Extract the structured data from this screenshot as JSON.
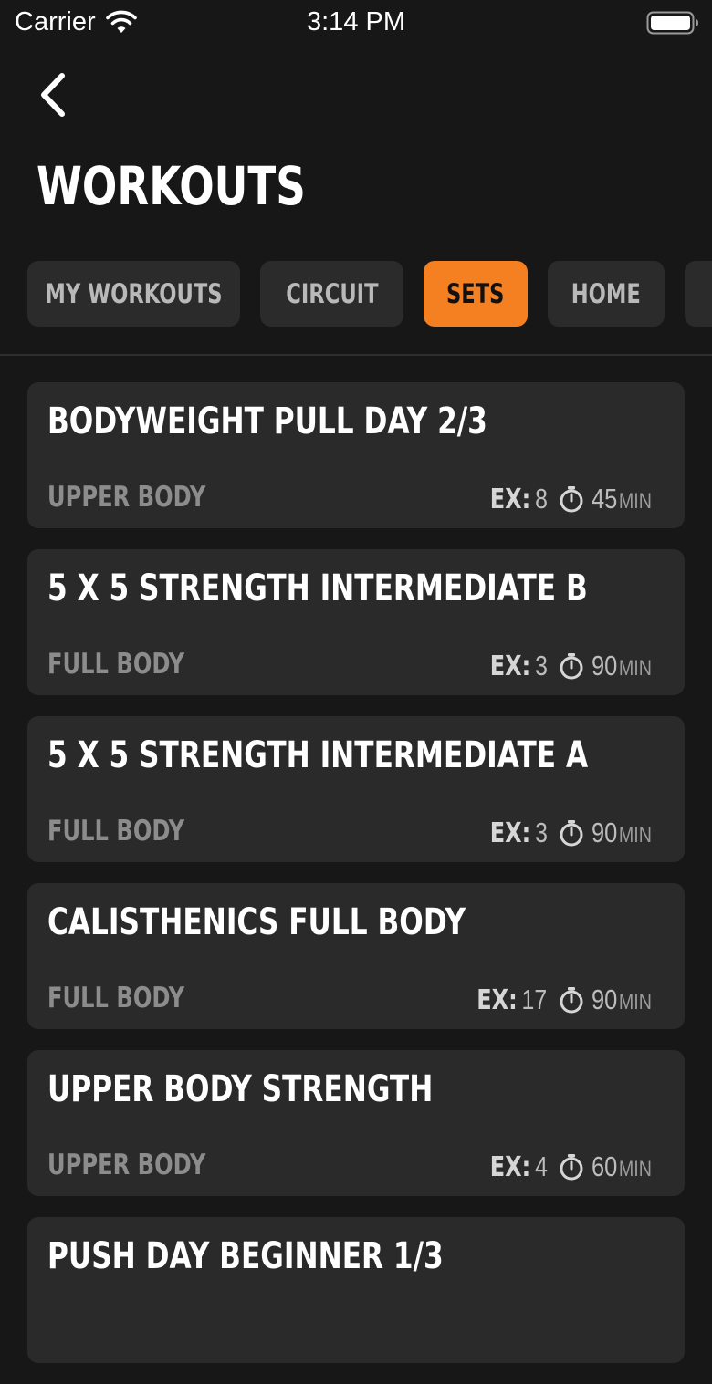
{
  "status_bar": {
    "carrier": "Carrier",
    "time": "3:14 PM",
    "wifi_icon": "wifi-icon",
    "battery_icon": "battery-icon"
  },
  "header": {
    "back_icon": "chevron-left-icon",
    "title": "WORKOUTS"
  },
  "tabs": [
    {
      "label": "MY WORKOUTS",
      "active": false
    },
    {
      "label": "CIRCUIT",
      "active": false
    },
    {
      "label": "SETS",
      "active": true
    },
    {
      "label": "HOME",
      "active": false
    },
    {
      "label": "",
      "active": false
    }
  ],
  "colors": {
    "background": "#171717",
    "card": "#2a2a2a",
    "tab": "#2b2b2b",
    "accent": "#f58021",
    "muted_text": "#8c8c8c"
  },
  "exercise_prefix": "EX:",
  "duration_unit": "MIN",
  "workouts": [
    {
      "title": "BODYWEIGHT PULL DAY 2/3",
      "category": "UPPER BODY",
      "exercises": "8",
      "duration": "45"
    },
    {
      "title": "5 X 5 STRENGTH INTERMEDIATE B",
      "category": "FULL BODY",
      "exercises": "3",
      "duration": "90"
    },
    {
      "title": "5 X 5 STRENGTH INTERMEDIATE A",
      "category": "FULL BODY",
      "exercises": "3",
      "duration": "90"
    },
    {
      "title": "CALISTHENICS FULL BODY",
      "category": "FULL BODY",
      "exercises": "17",
      "duration": "90"
    },
    {
      "title": "UPPER BODY STRENGTH",
      "category": "UPPER BODY",
      "exercises": "4",
      "duration": "60"
    },
    {
      "title": "PUSH DAY BEGINNER 1/3",
      "category": "",
      "exercises": "",
      "duration": ""
    }
  ]
}
